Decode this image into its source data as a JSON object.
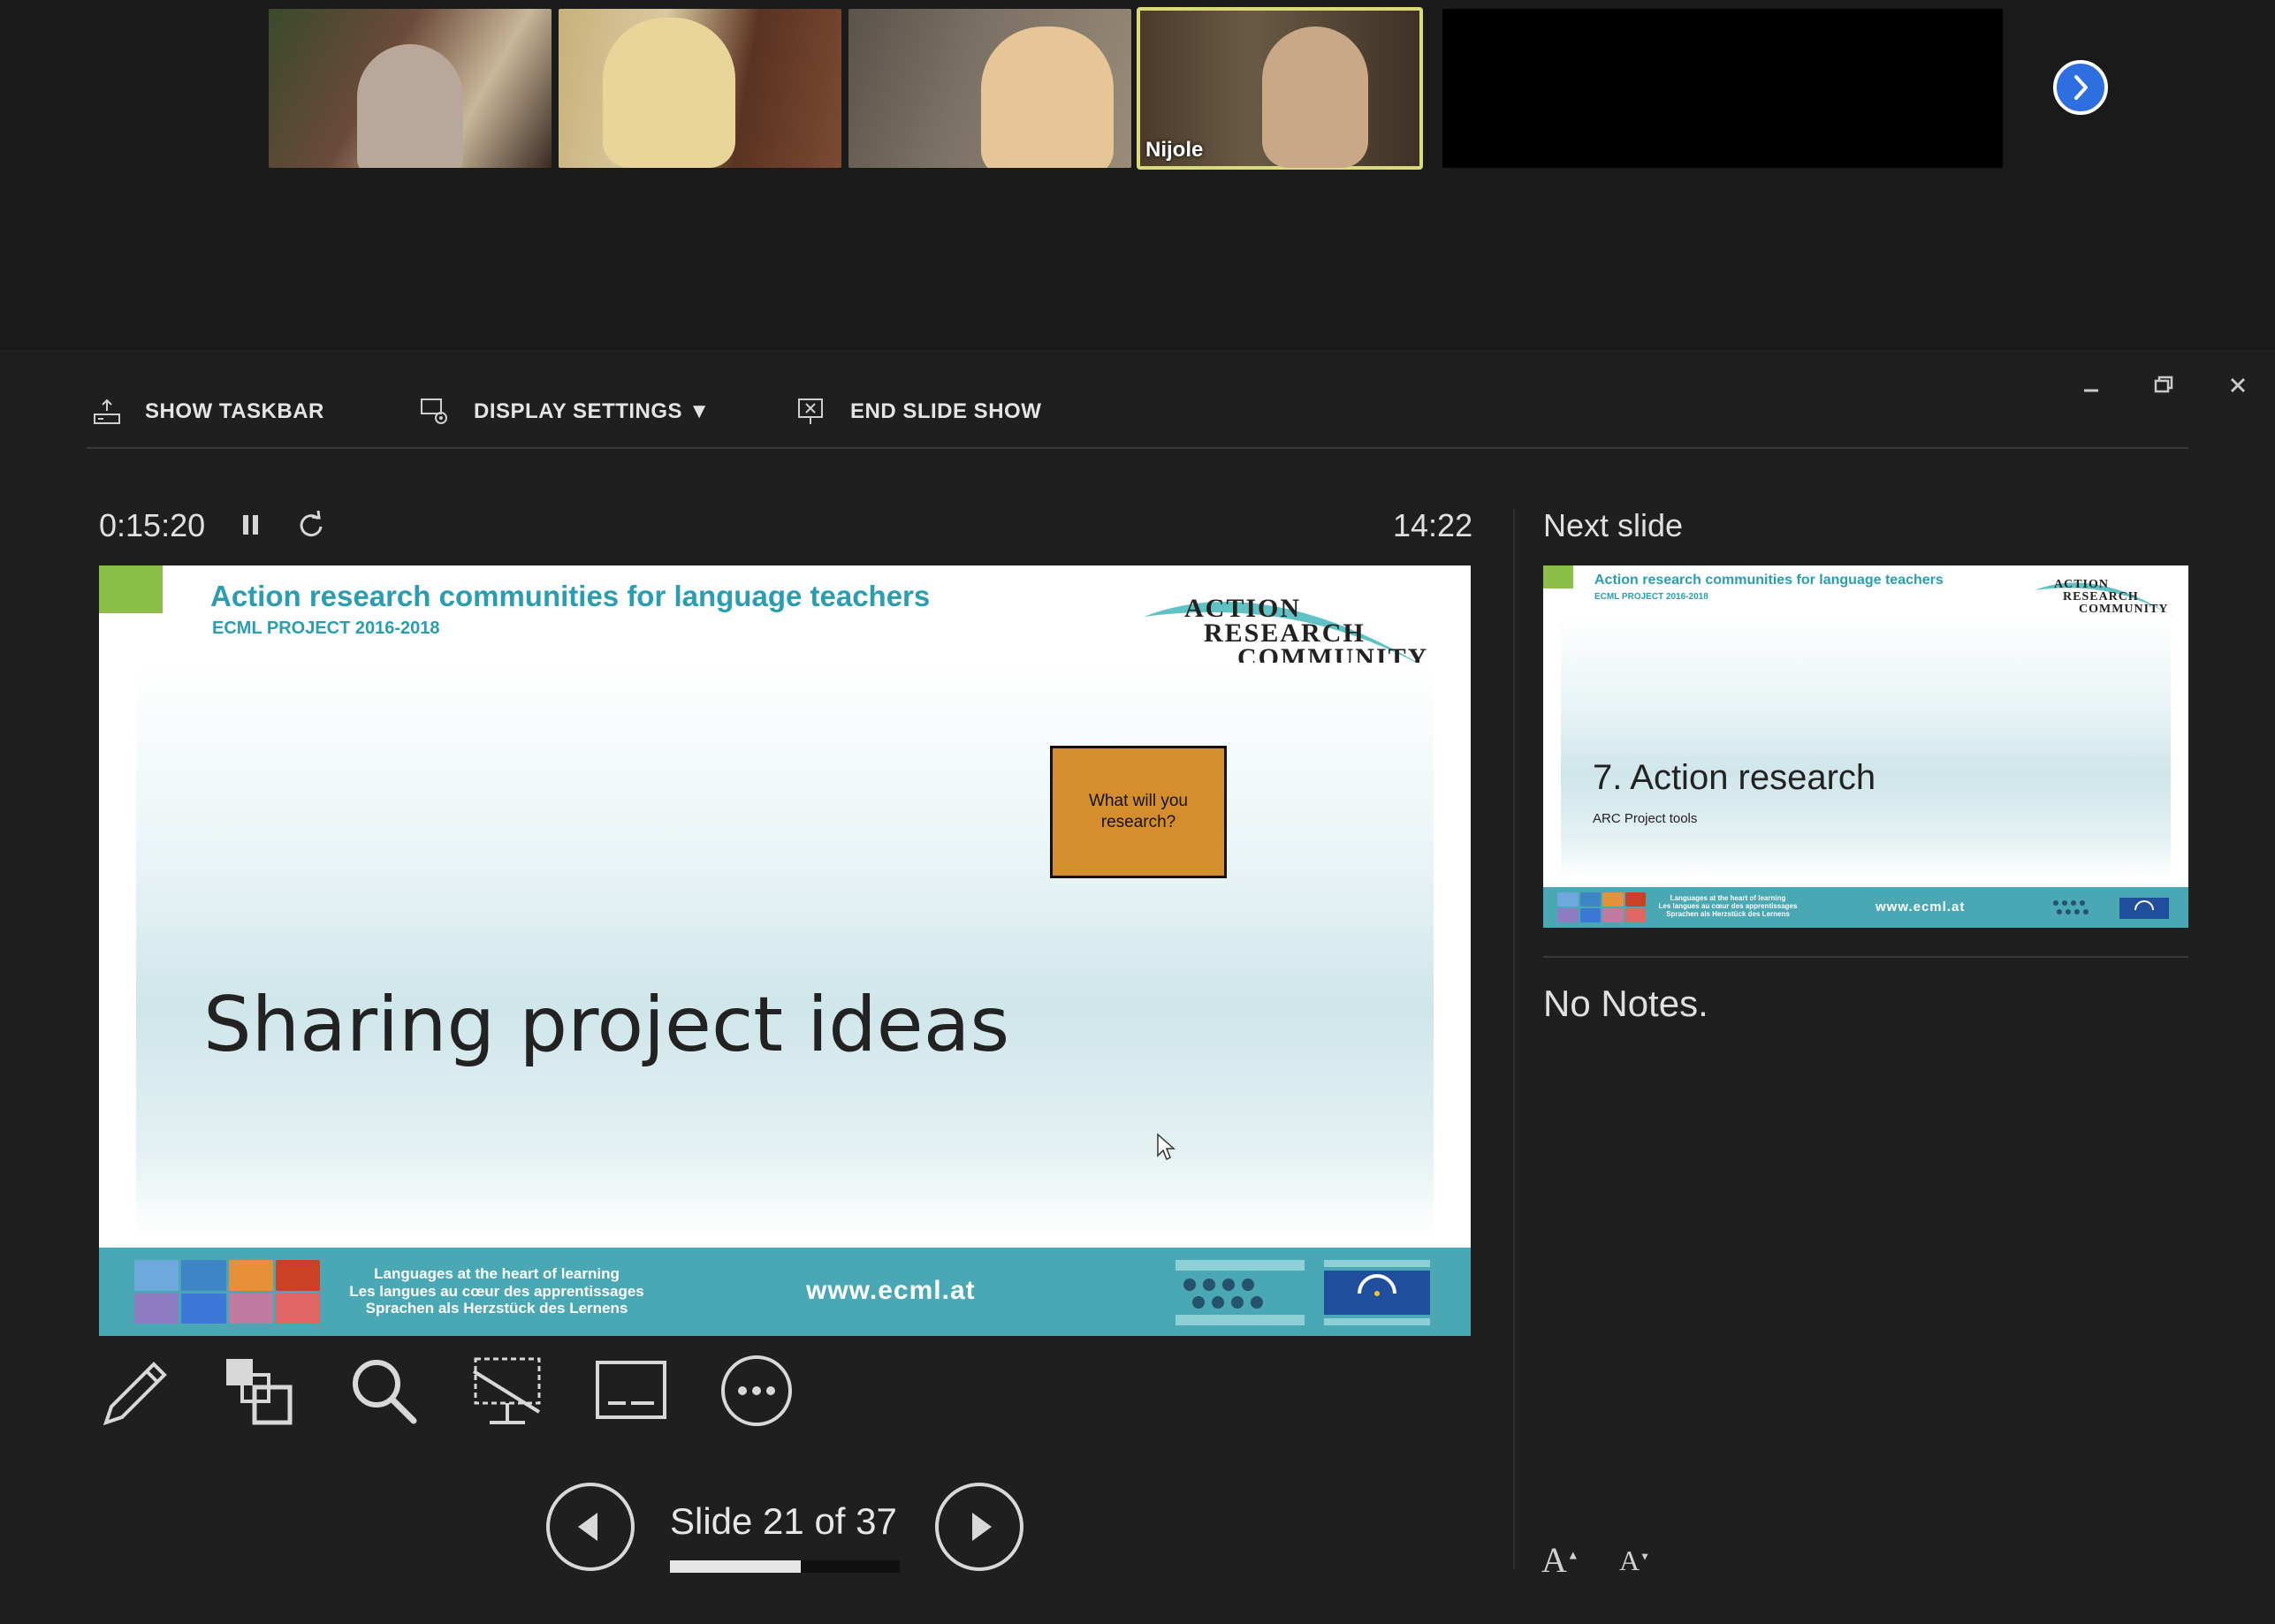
{
  "video_strip": {
    "participants": [
      {
        "name": ""
      },
      {
        "name": ""
      },
      {
        "name": ""
      },
      {
        "name": "Nijole",
        "active": true
      },
      {
        "name": ""
      },
      {
        "name": ""
      }
    ],
    "next_icon": "chevron-right-icon"
  },
  "window": {
    "minimize_icon": "minimize-icon",
    "restore_icon": "restore-icon",
    "close_icon": "close-icon"
  },
  "toolbar": {
    "show_taskbar": "SHOW TASKBAR",
    "display_settings": "DISPLAY SETTINGS ▼",
    "end_slide_show": "END SLIDE SHOW"
  },
  "timer": {
    "elapsed": "0:15:20",
    "clock": "14:22",
    "pause_icon": "pause-icon",
    "restart_icon": "restart-icon"
  },
  "current_slide": {
    "header_title": "Action research communities for language teachers",
    "header_subtitle": "ECML PROJECT 2016-2018",
    "logo_lines": [
      "ACTION",
      "RESEARCH",
      "COMMUNITY"
    ],
    "question_box": "What will you research?",
    "title": "Sharing project ideas",
    "footer_lines": [
      "Languages at the heart of learning",
      "Les langues au cœur des apprentissages",
      "Sprachen als Herzstück des Lernens"
    ],
    "footer_url": "www.ecml.at"
  },
  "tools": {
    "pen": "pen-icon",
    "slides": "see-all-slides-icon",
    "zoom": "zoom-icon",
    "black_screen": "black-screen-icon",
    "subtitles": "subtitles-icon",
    "more": "more-options-icon"
  },
  "navigation": {
    "prev_icon": "previous-slide-icon",
    "next_icon": "next-slide-icon",
    "counter": "Slide 21 of 37",
    "progress": 0.5676
  },
  "next_slide": {
    "label": "Next slide",
    "header_title": "Action research communities for language teachers",
    "header_subtitle": "ECML PROJECT 2016-2018",
    "logo_lines": [
      "ACTION",
      "RESEARCH",
      "COMMUNITY"
    ],
    "title": "7. Action research",
    "subtitle": "ARC Project tools",
    "footer_lines": [
      "Languages at the heart of learning",
      "Les langues au cœur des apprentissages",
      "Sprachen als Herzstück des Lernens"
    ],
    "footer_url": "www.ecml.at"
  },
  "notes": {
    "text": "No Notes.",
    "increase_font": "A",
    "decrease_font": "A"
  }
}
